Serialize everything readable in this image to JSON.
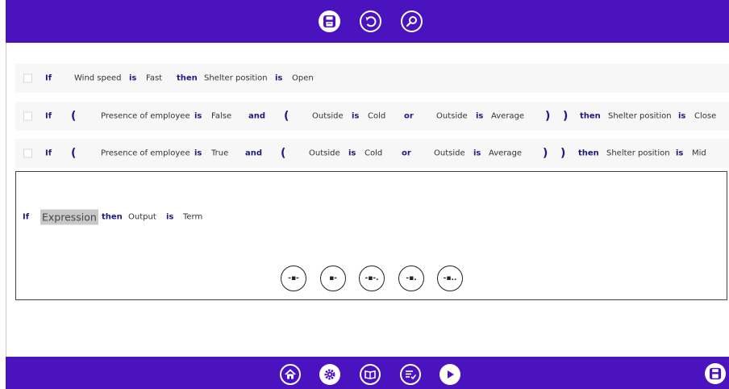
{
  "colors": {
    "bar": "#4b12c0",
    "keyword": "#1f1a80",
    "highlight": "#c8c8c8"
  },
  "top_toolbar": {
    "icons": [
      "save-icon",
      "undo-icon",
      "search-icon"
    ]
  },
  "rules": [
    {
      "tokens": [
        "If",
        "Wind speed",
        "is",
        "Fast",
        "then",
        "Shelter position",
        "is",
        "Open"
      ]
    },
    {
      "tokens": [
        "If",
        "(",
        "Presence of employee",
        "is",
        "False",
        "and",
        "(",
        "Outside",
        "is",
        "Cold",
        "or",
        "Outside",
        "is",
        "Average",
        ")",
        ")",
        "then",
        "Shelter position",
        "is",
        "Close"
      ]
    },
    {
      "tokens": [
        "If",
        "(",
        "Presence of employee",
        "is",
        "True",
        "and",
        "(",
        "Outside",
        "is",
        "Cold",
        "or",
        "Outside",
        "is",
        "Average",
        ")",
        ")",
        "then",
        "Shelter position",
        "is",
        "Mid"
      ]
    }
  ],
  "editor": {
    "if_label": "If",
    "expression": "Expression",
    "then_label": "then",
    "output": "Output",
    "is_label": "is",
    "term": "Term",
    "tools": [
      "-▪-",
      "▪-",
      "-▪-.",
      "-▪.",
      "-▪.."
    ]
  },
  "bottom_toolbar": {
    "icons": [
      "home-icon",
      "settings-icon",
      "book-icon",
      "checklist-icon",
      "play-icon"
    ],
    "right_icon": "save-icon"
  }
}
